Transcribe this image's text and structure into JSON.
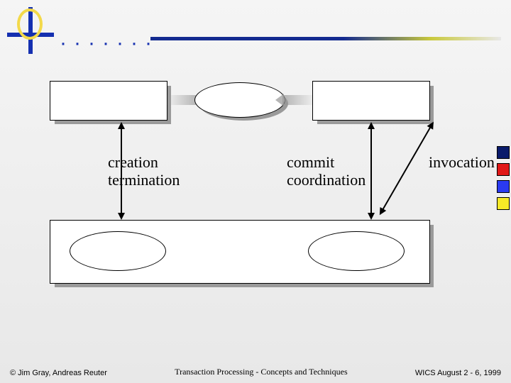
{
  "labels": {
    "creation_termination": "creation\ntermination",
    "commit_coordination": "commit\ncoordination",
    "invocation": "invocation"
  },
  "footer": {
    "copyright": "© Jim Gray, Andreas Reuter",
    "title": "Transaction Processing - Concepts and Techniques",
    "event": "WICS August 2 - 6, 1999"
  }
}
